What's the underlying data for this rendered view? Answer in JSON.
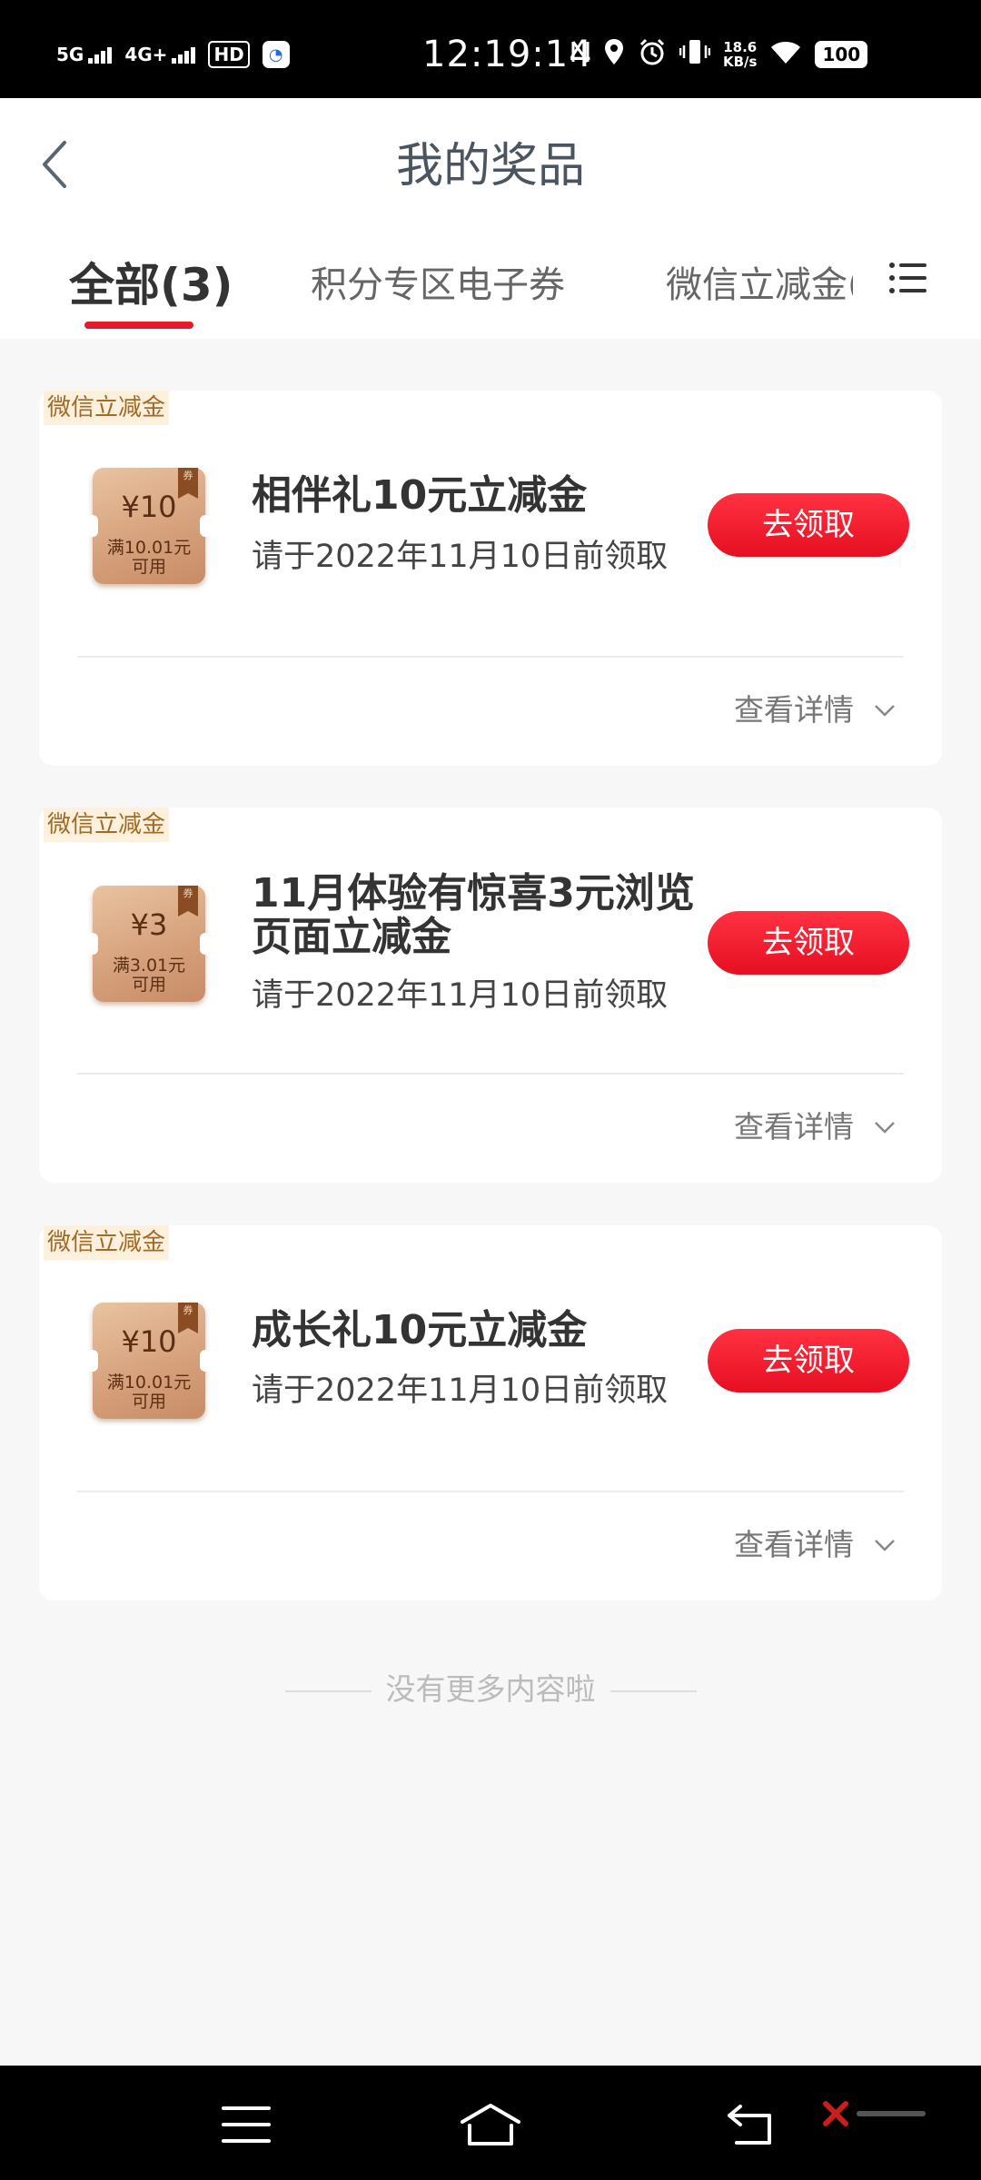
{
  "status_bar": {
    "time": "12:19:14",
    "network_1": "5G",
    "network_2": "4G+",
    "hd": "HD",
    "speed_value": "18.6",
    "speed_unit": "KB/s",
    "battery": "100"
  },
  "header": {
    "title": "我的奖品"
  },
  "tabs": [
    {
      "label": "全部(3)",
      "active": true
    },
    {
      "label": "积分专区电子券",
      "active": false
    },
    {
      "label": "微信立减金(",
      "active": false
    }
  ],
  "prizes": [
    {
      "tag": "微信立减金",
      "coupon_amount": "¥10",
      "coupon_condition_1": "满10.01元",
      "coupon_condition_2": "可用",
      "ribbon": "券",
      "title": "相伴礼10元立减金",
      "deadline": "请于2022年11月10日前领取",
      "button": "去领取",
      "details": "查看详情"
    },
    {
      "tag": "微信立减金",
      "coupon_amount": "¥3",
      "coupon_condition_1": "满3.01元",
      "coupon_condition_2": "可用",
      "ribbon": "券",
      "title": "11月体验有惊喜3元浏览页面立减金",
      "deadline": "请于2022年11月10日前领取",
      "button": "去领取",
      "details": "查看详情"
    },
    {
      "tag": "微信立减金",
      "coupon_amount": "¥10",
      "coupon_condition_1": "满10.01元",
      "coupon_condition_2": "可用",
      "ribbon": "券",
      "title": "成长礼10元立减金",
      "deadline": "请于2022年11月10日前领取",
      "button": "去领取",
      "details": "查看详情"
    }
  ],
  "footer": {
    "no_more": "没有更多内容啦"
  },
  "colors": {
    "accent": "#e21a2c",
    "tag_bg": "#fdf0dd",
    "tag_text": "#a06a28"
  }
}
